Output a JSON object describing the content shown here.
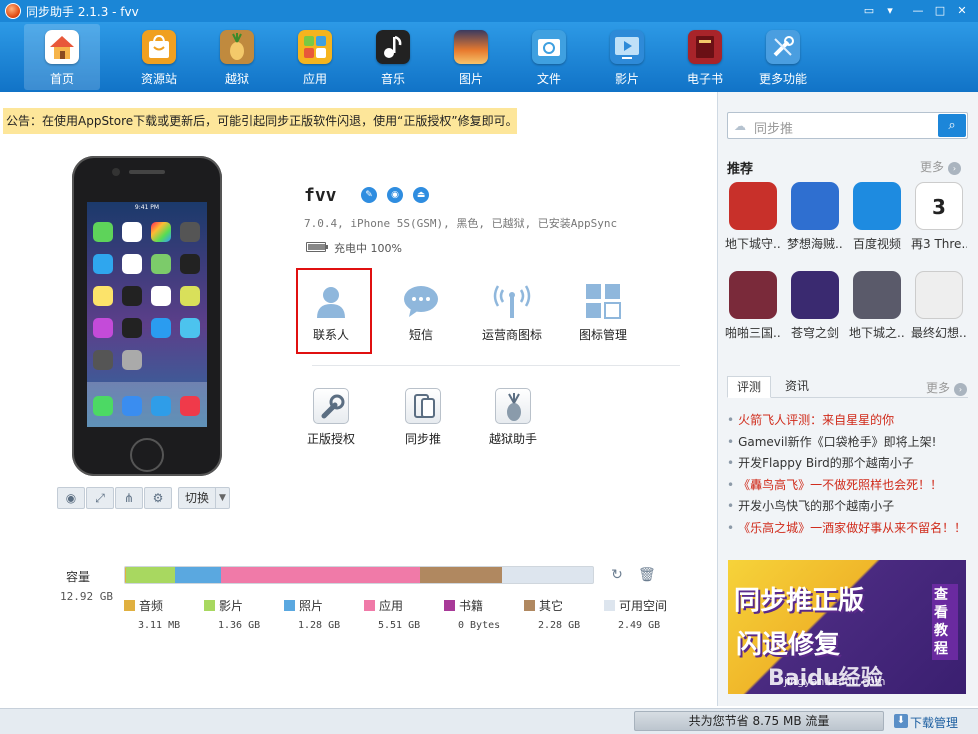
{
  "window": {
    "title": "同步助手 2.1.3 - fvv"
  },
  "toolbar": {
    "items": [
      {
        "label": "首页",
        "icon": "home-icon",
        "color": "#e8583a"
      },
      {
        "label": "资源站",
        "icon": "shopping-bag-icon",
        "color": "#f0a020"
      },
      {
        "label": "越狱",
        "icon": "pineapple-icon",
        "color": "#c08a3e"
      },
      {
        "label": "应用",
        "icon": "apps-grid-icon",
        "color": "#f5b41e"
      },
      {
        "label": "音乐",
        "icon": "music-note-icon",
        "color": "#222222"
      },
      {
        "label": "图片",
        "icon": "picture-icon",
        "color": "#e87a2e"
      },
      {
        "label": "文件",
        "icon": "folder-sync-icon",
        "color": "#3fa0e0"
      },
      {
        "label": "影片",
        "icon": "video-play-icon",
        "color": "#2e8ad8"
      },
      {
        "label": "电子书",
        "icon": "book-icon",
        "color": "#a8242a"
      },
      {
        "label": "更多功能",
        "icon": "tools-icon",
        "color": "#4a9ee0"
      }
    ]
  },
  "notice": {
    "text": "公告：在使用AppStore下载或更新后，可能引起同步正版软件闪退，使用“正版授权”修复即可。"
  },
  "phone": {
    "time": "9:41 PM",
    "switch_label": "切换"
  },
  "device": {
    "name": "fvv",
    "info": "7.0.4, iPhone 5S(GSM), 黑色, 已越狱, 已安装AppSync",
    "battery_text": "充电中 100%",
    "battery_level": 1.0
  },
  "features": [
    {
      "label": "联系人",
      "icon": "contacts-person-icon"
    },
    {
      "label": "短信",
      "icon": "message-bubble-icon"
    },
    {
      "label": "运营商图标",
      "icon": "signal-antenna-icon"
    },
    {
      "label": "图标管理",
      "icon": "icon-grid-icon"
    }
  ],
  "tools": [
    {
      "label": "正版授权",
      "icon": "wrench-icon"
    },
    {
      "label": "同步推",
      "icon": "sync-devices-icon"
    },
    {
      "label": "越狱助手",
      "icon": "pineapple-tool-icon"
    }
  ],
  "capacity": {
    "label": "容量",
    "total": "12.92 GB",
    "segments": [
      {
        "name": "音频",
        "value": "3.11 MB",
        "color": "#e0b040",
        "fraction": 0.003
      },
      {
        "name": "影片",
        "value": "1.36 GB",
        "color": "#a8d860",
        "fraction": 0.105
      },
      {
        "name": "照片",
        "value": "1.28 GB",
        "color": "#5aa8e0",
        "fraction": 0.099
      },
      {
        "name": "应用",
        "value": "5.51 GB",
        "color": "#f07aa8",
        "fraction": 0.426
      },
      {
        "name": "书籍",
        "value": "0 Bytes",
        "color": "#a83a98",
        "fraction": 0.0
      },
      {
        "name": "其它",
        "value": "2.28 GB",
        "color": "#b08860",
        "fraction": 0.176
      },
      {
        "name": "可用空间",
        "value": "2.49 GB",
        "color": "#dde5ee",
        "fraction": 0.191
      }
    ]
  },
  "search": {
    "placeholder": "同步推",
    "button_icon": "search-icon"
  },
  "recommend": {
    "title": "推荐",
    "more": "更多",
    "apps": [
      {
        "label": "地下城守...",
        "color": "#c8302a",
        "text": ""
      },
      {
        "label": "梦想海贼...",
        "color": "#2f6fd0",
        "text": ""
      },
      {
        "label": "百度视频",
        "color": "#1e8be0",
        "text": ""
      },
      {
        "label": "再3 Thre...",
        "color": "#ffffff",
        "text": "3"
      },
      {
        "label": "啪啪三国...",
        "color": "#7a2a3a",
        "text": ""
      },
      {
        "label": "苍穹之剑",
        "color": "#3a2a70",
        "text": ""
      },
      {
        "label": "地下城之...",
        "color": "#5a5a6a",
        "text": ""
      },
      {
        "label": "最终幻想...",
        "color": "#eeeeee",
        "text": ""
      }
    ]
  },
  "news_tabs": {
    "tabs": [
      "评测",
      "资讯"
    ],
    "more": "更多"
  },
  "news": [
    {
      "text": "火箭飞人评测：来自星星的你",
      "color": "#d02a1a"
    },
    {
      "text": "Gamevil新作《口袋枪手》即将上架!",
      "color": "#333333"
    },
    {
      "text": "开发Flappy Bird的那个越南小子",
      "color": "#333333"
    },
    {
      "text": "《轟鸟高飞》一不做死照样也会死！！",
      "color": "#d02a1a"
    },
    {
      "text": "开发小鸟快飞的那个越南小子",
      "color": "#333333"
    },
    {
      "text": "《乐高之城》一酒家做好事从来不留名！！",
      "color": "#d02a1a"
    }
  ],
  "banner": {
    "line1": "同步推正版",
    "line2": "闪退修复",
    "side": "查看教程",
    "watermark": "Baidu经验",
    "watermark_url": "jingyan.baidu.com"
  },
  "statusbar": {
    "saved": "共为您节省 8.75 MB 流量",
    "download": "下载管理"
  }
}
